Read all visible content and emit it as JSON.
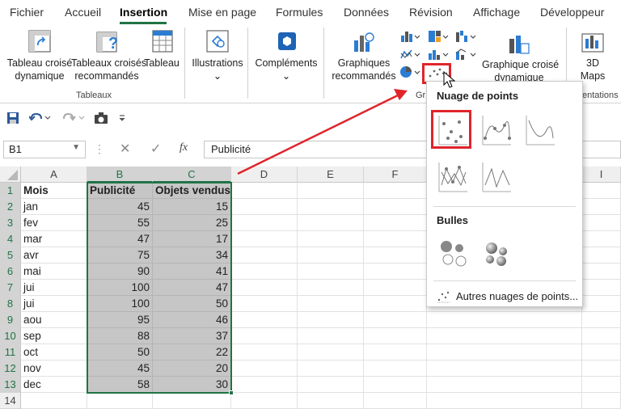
{
  "menu": {
    "tabs": [
      "Fichier",
      "Accueil",
      "Insertion",
      "Mise en page",
      "Formules",
      "Données",
      "Révision",
      "Affichage",
      "Développeur"
    ],
    "active": "Insertion"
  },
  "ribbon": {
    "pivot_table": [
      "Tableau croisé",
      "dynamique"
    ],
    "recommended_pivot": [
      "Tableaux croisés",
      "recommandés"
    ],
    "table": "Tableau",
    "group_tables": "Tableaux",
    "illustrations": "Illustrations",
    "addins": "Compléments",
    "recommended_charts": [
      "Graphiques",
      "recommandés"
    ],
    "pivot_chart": [
      "Graphique croisé",
      "dynamique"
    ],
    "maps_3d": [
      "3D",
      "Maps"
    ],
    "group_charts_partial": "Gr",
    "group_tours_partial": "entations"
  },
  "formula_bar": {
    "name_box": "B1",
    "fx": "fx",
    "content": "Publicité"
  },
  "sheet": {
    "columns": [
      "A",
      "B",
      "C",
      "D",
      "E",
      "F",
      "I"
    ],
    "rows": [
      [
        "Mois",
        "Publicité",
        "Objets vendus"
      ],
      [
        "jan",
        "45",
        "15"
      ],
      [
        "fev",
        "55",
        "25"
      ],
      [
        "mar",
        "47",
        "17"
      ],
      [
        "avr",
        "75",
        "34"
      ],
      [
        "mai",
        "90",
        "41"
      ],
      [
        "jui",
        "100",
        "47"
      ],
      [
        "jui",
        "100",
        "50"
      ],
      [
        "aou",
        "95",
        "46"
      ],
      [
        "sep",
        "88",
        "37"
      ],
      [
        "oct",
        "50",
        "22"
      ],
      [
        "nov",
        "45",
        "20"
      ],
      [
        "dec",
        "58",
        "30"
      ],
      [
        "",
        "",
        ""
      ]
    ],
    "row_numbers": [
      "1",
      "2",
      "3",
      "4",
      "5",
      "6",
      "7",
      "8",
      "9",
      "10",
      "11",
      "12",
      "13",
      "14"
    ]
  },
  "dropdown": {
    "scatter_title": "Nuage de points",
    "bubble_title": "Bulles",
    "more_scatter": "Autres nuages de points..."
  },
  "colors": {
    "excel_green": "#217346",
    "highlight_red": "#e0242b",
    "selection_gray": "#c6c6c6"
  }
}
